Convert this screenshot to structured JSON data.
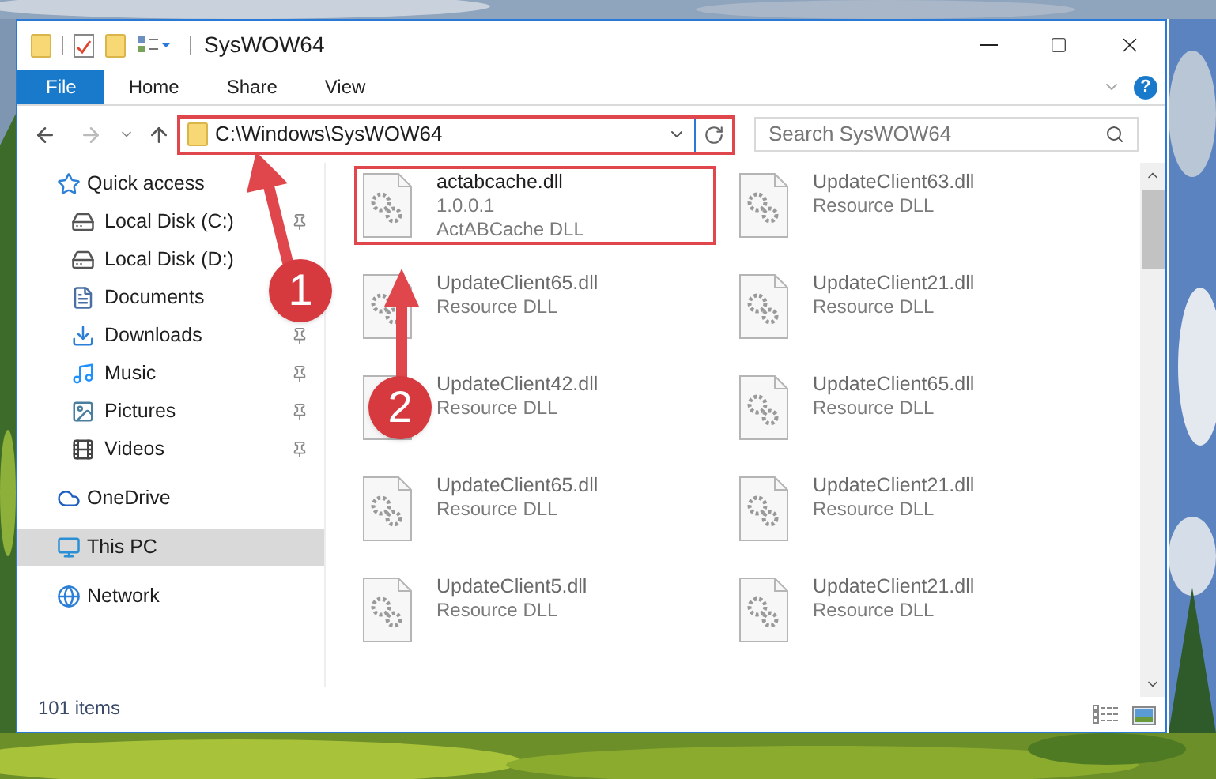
{
  "window": {
    "title": "SysWOW64"
  },
  "ribbon_tabs": [
    {
      "label": "File",
      "selected": true
    },
    {
      "label": "Home",
      "selected": false
    },
    {
      "label": "Share",
      "selected": false
    },
    {
      "label": "View",
      "selected": false
    }
  ],
  "help": {
    "label": "?"
  },
  "address": {
    "value": "C:\\Windows\\SysWOW64"
  },
  "search": {
    "placeholder": "Search SysWOW64"
  },
  "nav_pane": [
    {
      "label": "Quick access",
      "kind": "star",
      "selected": false,
      "children": [
        {
          "label": "Local Disk (C:)",
          "kind": "disk",
          "pinned": true
        },
        {
          "label": "Local Disk (D:)",
          "kind": "disk",
          "pinned": false
        },
        {
          "label": "Documents",
          "kind": "doc",
          "pinned": false
        },
        {
          "label": "Downloads",
          "kind": "download",
          "pinned": true
        },
        {
          "label": "Music",
          "kind": "music",
          "pinned": true
        },
        {
          "label": "Pictures",
          "kind": "pictures",
          "pinned": true
        },
        {
          "label": "Videos",
          "kind": "videos",
          "pinned": true
        }
      ]
    },
    {
      "label": "OneDrive",
      "kind": "cloud",
      "selected": false
    },
    {
      "label": "This PC",
      "kind": "pc",
      "selected": true
    },
    {
      "label": "Network",
      "kind": "network",
      "selected": false
    }
  ],
  "files": [
    {
      "name": "actabcache.dll",
      "lines": [
        "1.0.0.1",
        "ActABCache DLL"
      ],
      "highlighted": true
    },
    {
      "name": "UpdateClient63.dll",
      "lines": [
        "Resource DLL"
      ],
      "highlighted": false
    },
    {
      "name": "UpdateClient65.dll",
      "lines": [
        "Resource DLL"
      ],
      "highlighted": false
    },
    {
      "name": "UpdateClient21.dll",
      "lines": [
        "Resource DLL"
      ],
      "highlighted": false
    },
    {
      "name": "UpdateClient42.dll",
      "lines": [
        "Resource DLL"
      ],
      "highlighted": false
    },
    {
      "name": "UpdateClient65.dll",
      "lines": [
        "Resource DLL"
      ],
      "highlighted": false
    },
    {
      "name": "UpdateClient65.dll",
      "lines": [
        "Resource DLL"
      ],
      "highlighted": false
    },
    {
      "name": "UpdateClient21.dll",
      "lines": [
        "Resource DLL"
      ],
      "highlighted": false
    },
    {
      "name": "UpdateClient5.dll",
      "lines": [
        "Resource DLL"
      ],
      "highlighted": false
    },
    {
      "name": "UpdateClient21.dll",
      "lines": [
        "Resource DLL"
      ],
      "highlighted": false
    }
  ],
  "status_bar": {
    "count": "101 items"
  },
  "annotations": [
    {
      "number": "1"
    },
    {
      "number": "2"
    }
  ]
}
